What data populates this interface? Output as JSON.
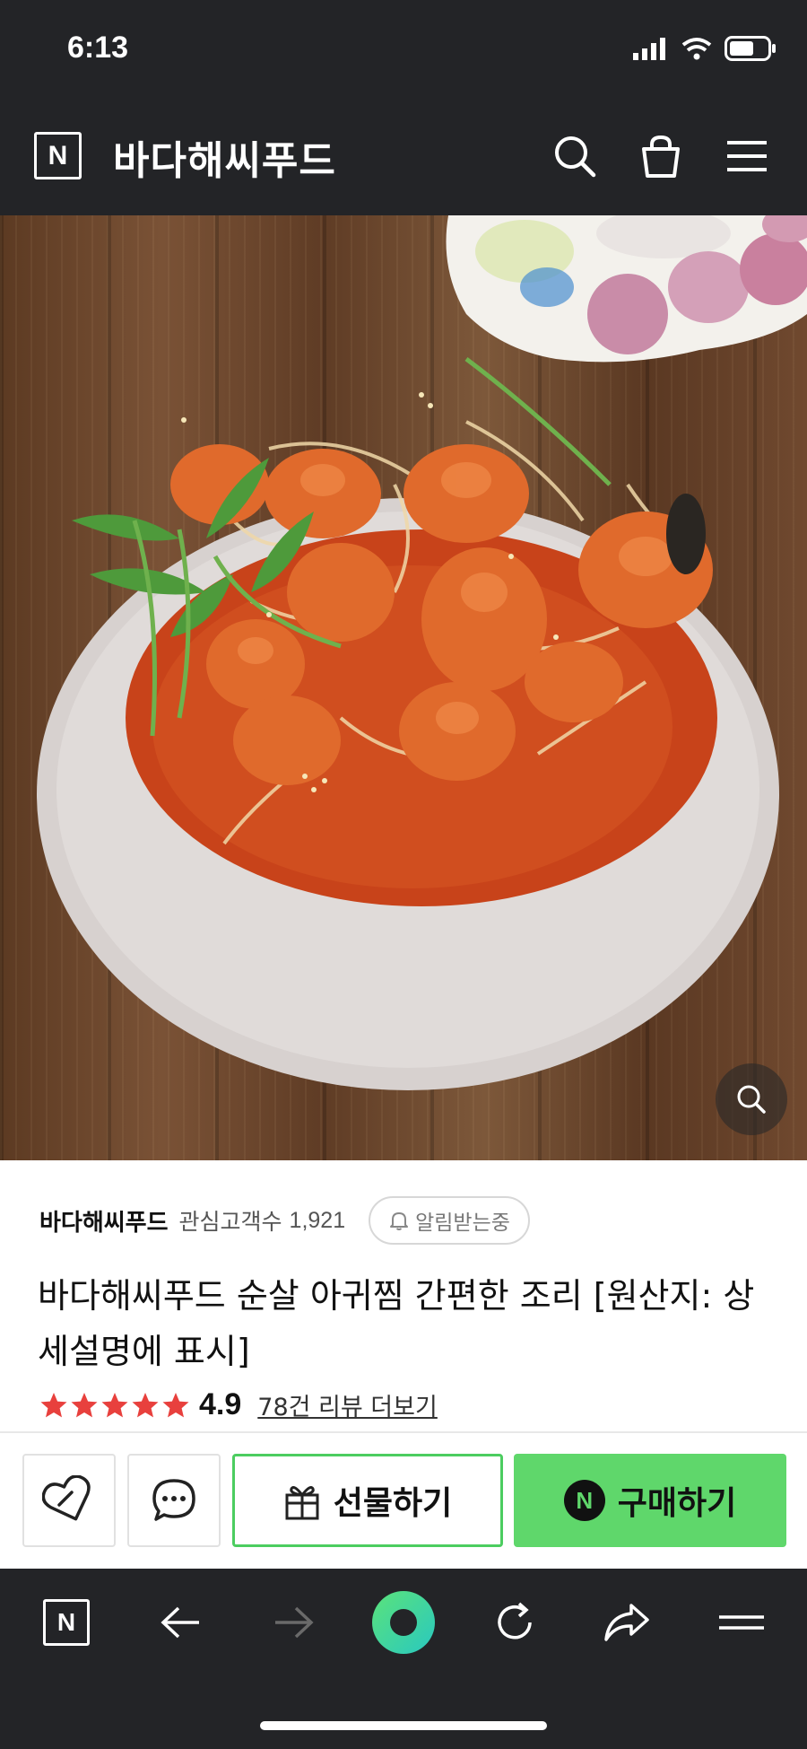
{
  "status_bar": {
    "time": "6:13"
  },
  "header": {
    "logo": "N",
    "store_name": "바다해씨푸드"
  },
  "seller": {
    "name": "바다해씨푸드",
    "fans_label": "관심고객수",
    "fans_count": "1,921",
    "alarm_label": "알림받는중"
  },
  "product": {
    "title": "바다해씨푸드 순살 아귀찜 간편한 조리 [원산지: 상세설명에 표시]"
  },
  "rating": {
    "score": "4.9",
    "stars": 5,
    "review_link": "78건 리뷰 더보기"
  },
  "buy_bar": {
    "gift_label": "선물하기",
    "buy_label": "구매하기",
    "buy_badge": "N"
  },
  "browser_bar": {
    "home_label": "N"
  },
  "colors": {
    "dark": "#232427",
    "accent_green": "#5fd76b",
    "gift_border": "#4ccd60",
    "star": "#e8403d"
  },
  "icons": [
    "search-icon",
    "cart-icon",
    "menu-icon",
    "zoom-icon",
    "bell-icon",
    "star-icon",
    "heart-icon",
    "chat-icon",
    "gift-icon",
    "back-arrow-icon",
    "forward-arrow-icon",
    "refresh-icon",
    "share-icon"
  ]
}
